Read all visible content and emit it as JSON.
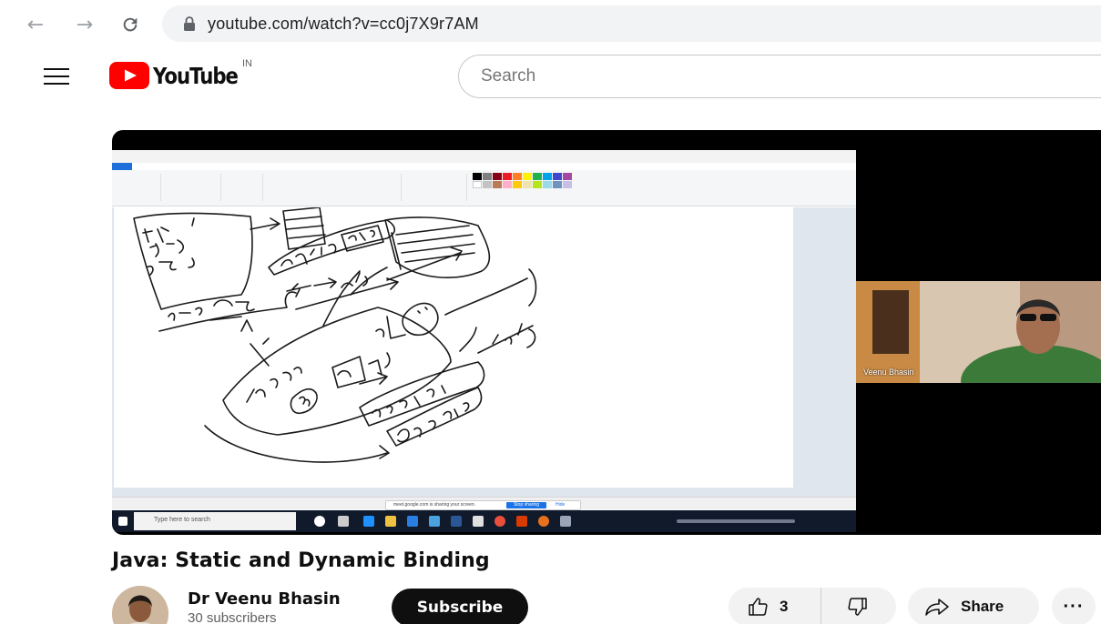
{
  "browser": {
    "back_icon": "arrow-left-icon",
    "forward_icon": "arrow-right-icon",
    "reload_icon": "reload-icon",
    "lock_icon": "lock-icon",
    "url": "youtube.com/watch?v=cc0j7X9r7AM"
  },
  "masthead": {
    "menu_icon": "hamburger-icon",
    "logo_text": "YouTube",
    "country_code": "IN",
    "search_placeholder": "Search"
  },
  "player": {
    "webcam_name": "Veenu Bhasin",
    "share_notice": "meet.google.com is sharing your screen.",
    "stop_sharing_label": "Stop sharing",
    "hide_label": "Hide",
    "taskbar_search": "Type here to search"
  },
  "video": {
    "title": "Java: Static and Dynamic Binding"
  },
  "channel": {
    "name": "Dr Veenu Bhasin",
    "subscribers": "30 subscribers",
    "subscribe_label": "Subscribe"
  },
  "actions": {
    "like_count": "3",
    "share_label": "Share",
    "more_label": "···"
  },
  "colors": {
    "youtube_red": "#ff0000",
    "subscribe_bg": "#0f0f0f",
    "action_bg": "#f2f2f2"
  }
}
